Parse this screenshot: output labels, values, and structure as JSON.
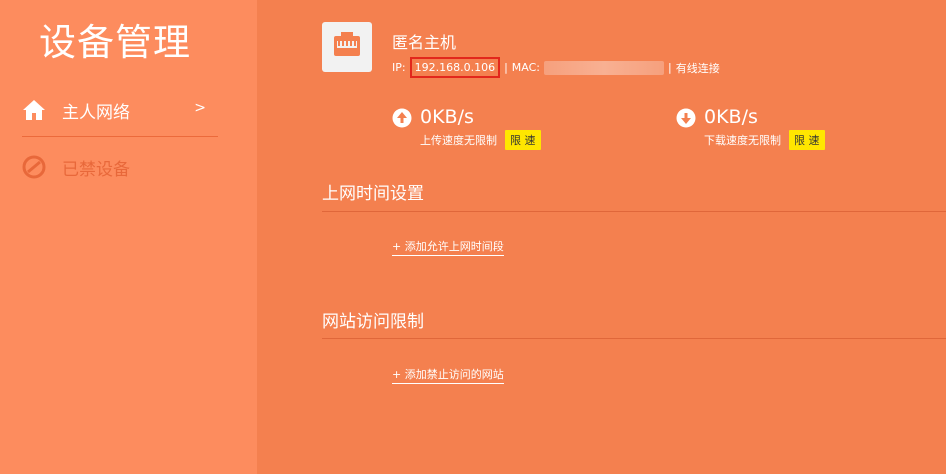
{
  "app": {
    "title": "设备管理"
  },
  "sidebar": {
    "items": [
      {
        "label": "主人网络",
        "icon": "home-icon",
        "chevron": ">"
      },
      {
        "label": "已禁设备",
        "icon": "blocked-icon"
      }
    ]
  },
  "device": {
    "name": "匿名主机",
    "ip_label": "IP:",
    "ip_value": "192.168.0.106",
    "separator": "|",
    "mac_label": "MAC:",
    "connection": "有线连接",
    "icon": "ethernet-port-icon"
  },
  "upload": {
    "value": "0KB/s",
    "status": "上传速度无限制",
    "limit_label": "限 速",
    "icon": "upload-arrow-icon"
  },
  "download": {
    "value": "0KB/s",
    "status": "下载速度无限制",
    "limit_label": "限 速",
    "icon": "download-arrow-icon"
  },
  "sections": {
    "time": {
      "title": "上网时间设置",
      "add_label": "+ 添加允许上网时间段"
    },
    "site": {
      "title": "网站访问限制",
      "add_label": "+ 添加禁止访问的网站"
    }
  },
  "colors": {
    "main_bg": "#f4804f",
    "sidebar_bg": "#fd8c5e",
    "limit_button": "#ffe600",
    "ip_highlight": "#e2271c"
  }
}
